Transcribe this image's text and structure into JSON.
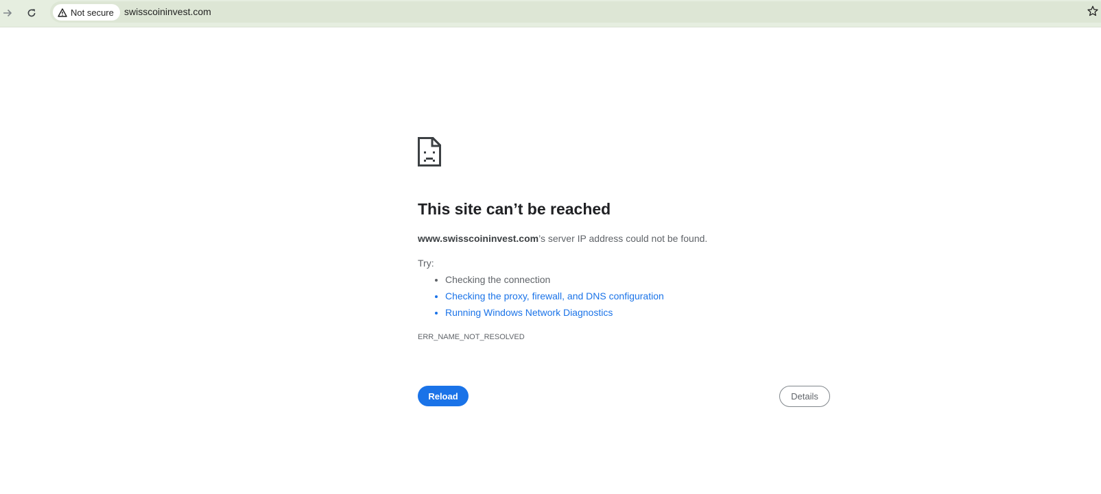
{
  "browser": {
    "security_label": "Not secure",
    "url": "swisscoininvest.com",
    "icons": {
      "forward": "arrow-right-icon",
      "reload": "reload-icon",
      "warning": "warning-triangle-icon",
      "bookmark": "star-icon"
    }
  },
  "error": {
    "icon": "sad-page-icon",
    "title": "This site can’t be reached",
    "host": "www.swisscoininvest.com",
    "message_suffix": "’s server IP address could not be found.",
    "try_label": "Try:",
    "suggestions": [
      "Checking the connection",
      "Checking the proxy, firewall, and DNS configuration",
      "Running Windows Network Diagnostics"
    ],
    "code": "ERR_NAME_NOT_RESOLVED",
    "reload_label": "Reload",
    "details_label": "Details"
  },
  "colors": {
    "toolbar": "#e6eee0",
    "link": "#1a73e8",
    "primary_button": "#1a73e8"
  }
}
